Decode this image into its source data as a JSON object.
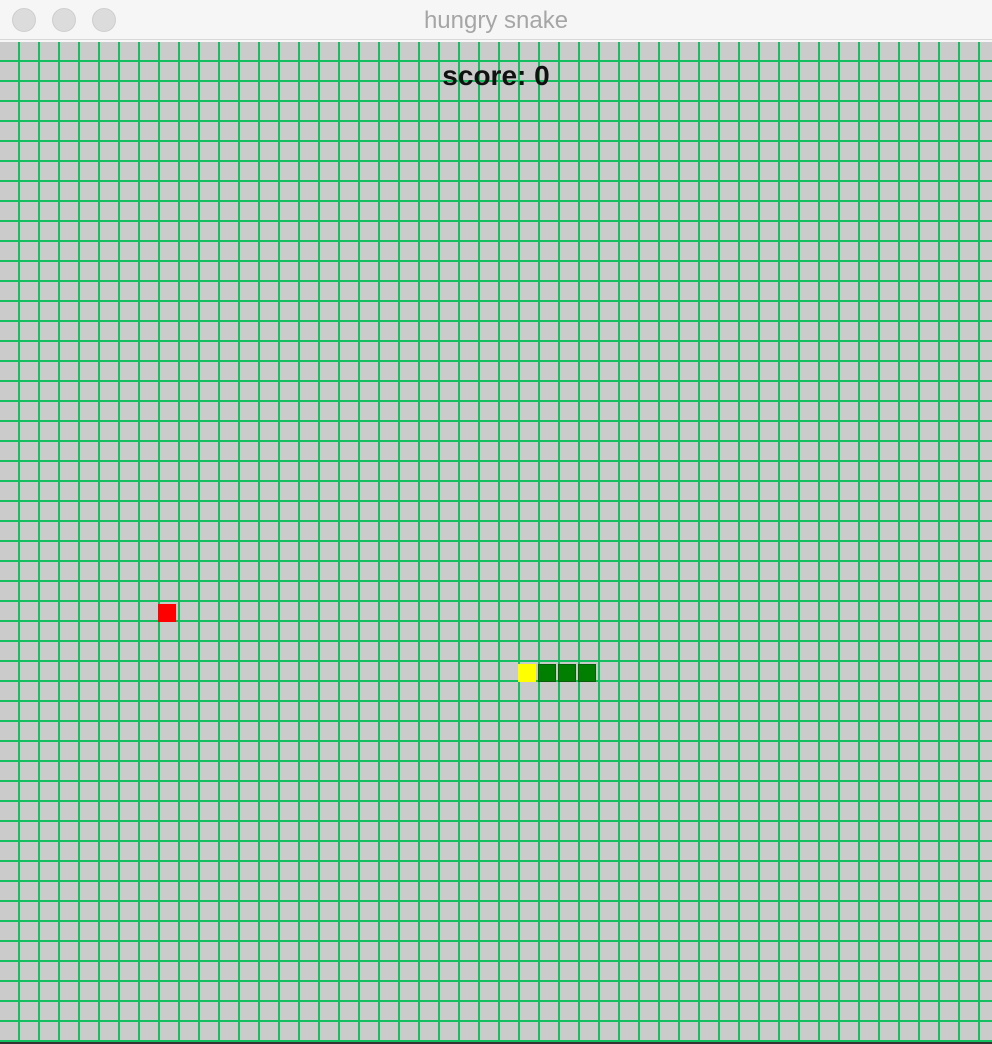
{
  "window": {
    "title": "hungry snake"
  },
  "game": {
    "score_label": "score: 0",
    "colors": {
      "background": "#cbcbcb",
      "grid": "#13bf5f",
      "food": "#ff0000",
      "snake_head": "#ffff00",
      "snake_body": "#007f00"
    }
  }
}
